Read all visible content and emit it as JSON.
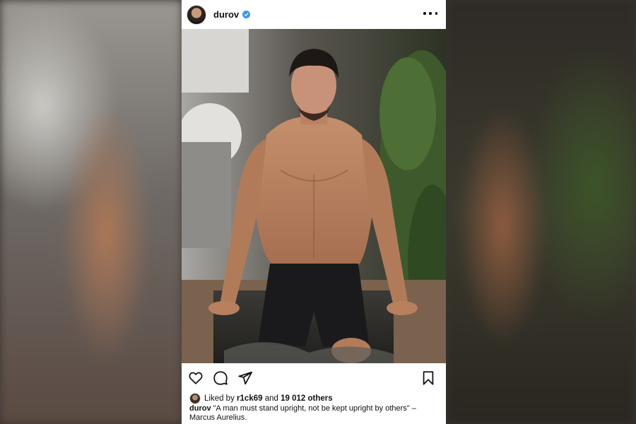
{
  "post": {
    "username": "durov",
    "verified": true,
    "menu_icon": "more-horizontal-icon",
    "photo_subject": "",
    "liked_by_prefix": "Liked by",
    "liked_by_user": "r1ck69",
    "liked_by_joiner": "and",
    "liked_by_others": "19 012 others",
    "caption_username": "durov",
    "caption_text": "\"A man must stand upright, not be kept upright by others\" – Marcus Aurelius.",
    "icons": {
      "like": "heart-icon",
      "comment": "comment-bubble-icon",
      "share": "paper-plane-icon",
      "save": "bookmark-icon",
      "verified": "verified-badge-icon"
    }
  },
  "colors": {
    "verified_blue": "#3897f0",
    "text": "#111111",
    "card": "#ffffff"
  }
}
